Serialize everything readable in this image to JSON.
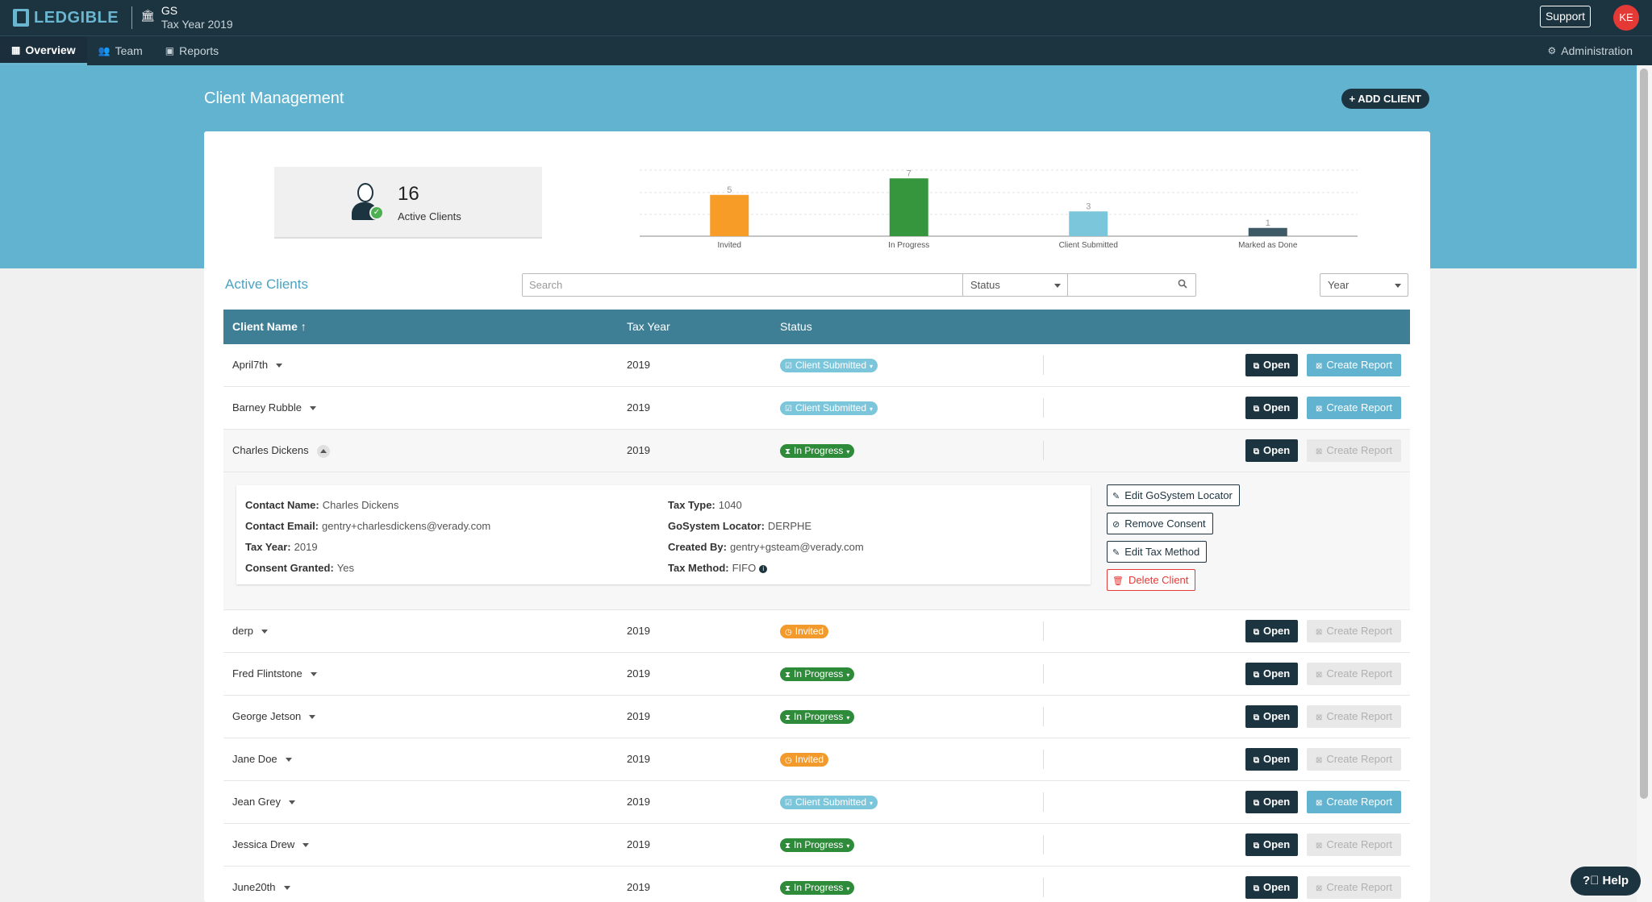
{
  "app": {
    "logo_text": "LEDGIBLE",
    "org_name": "GS",
    "org_year": "Tax Year 2019"
  },
  "topbar": {
    "support_label": "Support",
    "avatar_initials": "KE"
  },
  "nav": {
    "items": [
      {
        "label": "Overview",
        "icon": "dashboard-icon",
        "active": true
      },
      {
        "label": "Team",
        "icon": "people-icon",
        "active": false
      },
      {
        "label": "Reports",
        "icon": "report-icon",
        "active": false
      }
    ],
    "admin_label": "Administration"
  },
  "page": {
    "title": "Client Management",
    "add_client_label": "+ ADD CLIENT"
  },
  "stats": {
    "active_clients_count": "16",
    "active_clients_label": "Active Clients"
  },
  "chart_data": {
    "type": "bar",
    "categories": [
      "Invited",
      "In Progress",
      "Client Submitted",
      "Marked as Done"
    ],
    "values": [
      5,
      7,
      3,
      1
    ],
    "colors": [
      "#f89c28",
      "#35963d",
      "#7cc6dc",
      "#3d5a66"
    ],
    "ylim": [
      0,
      8
    ],
    "grid": true
  },
  "list": {
    "title": "Active Clients",
    "search_placeholder": "Search",
    "status_filter": "Status",
    "year_filter": "Year",
    "columns": [
      "Client Name ↑",
      "Tax Year",
      "Status"
    ],
    "open_label": "Open",
    "create_report_label": "Create Report",
    "rows": [
      {
        "name": "April7th",
        "year": "2019",
        "status": "Client Submitted"
      },
      {
        "name": "Barney Rubble",
        "year": "2019",
        "status": "Client Submitted"
      },
      {
        "name": "Charles Dickens",
        "year": "2019",
        "status": "In Progress"
      },
      {
        "name": "derp",
        "year": "2019",
        "status": "Invited"
      },
      {
        "name": "Fred Flintstone",
        "year": "2019",
        "status": "In Progress"
      },
      {
        "name": "George Jetson",
        "year": "2019",
        "status": "In Progress"
      },
      {
        "name": "Jane Doe",
        "year": "2019",
        "status": "Invited"
      },
      {
        "name": "Jean Grey",
        "year": "2019",
        "status": "Client Submitted"
      },
      {
        "name": "Jessica Drew",
        "year": "2019",
        "status": "In Progress"
      },
      {
        "name": "June20th",
        "year": "2019",
        "status": "In Progress"
      }
    ]
  },
  "details": {
    "contact_name_label": "Contact Name:",
    "contact_name": "Charles Dickens",
    "contact_email_label": "Contact Email:",
    "contact_email": "gentry+charlesdickens@verady.com",
    "tax_year_label": "Tax Year:",
    "tax_year": "2019",
    "consent_label": "Consent Granted:",
    "consent": "Yes",
    "tax_type_label": "Tax Type:",
    "tax_type": "1040",
    "locator_label": "GoSystem Locator:",
    "locator": "DERPHE",
    "created_by_label": "Created By:",
    "created_by": "gentry+gsteam@verady.com",
    "tax_method_label": "Tax Method:",
    "tax_method": "FIFO",
    "actions": {
      "edit_locator": "Edit GoSystem Locator",
      "remove_consent": "Remove Consent",
      "edit_tax_method": "Edit Tax Method",
      "delete_client": "Delete Client"
    }
  },
  "help_label": "Help"
}
